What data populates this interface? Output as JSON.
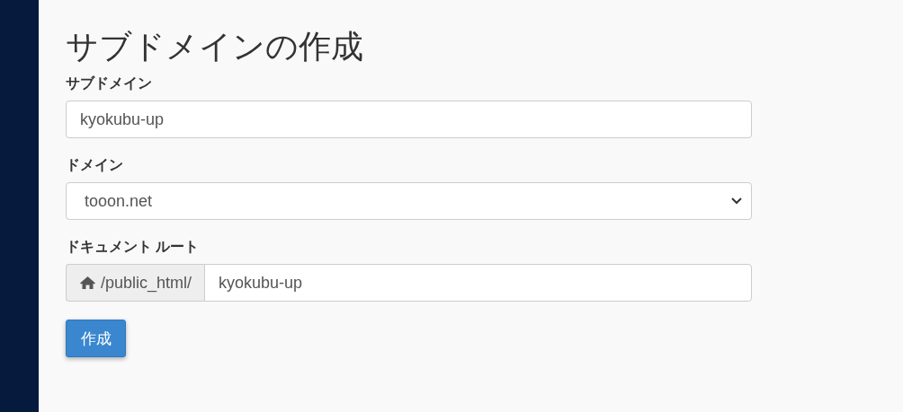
{
  "page_title": "サブドメインの作成",
  "fields": [
    {
      "kind": "text",
      "label": "サブドメイン",
      "value": "kyokubu-up"
    },
    {
      "kind": "select",
      "label": "ドメイン",
      "value": "tooon.net"
    },
    {
      "kind": "addon",
      "label": "ドキュメント ルート",
      "addon": "/public_html/",
      "value": "kyokubu-up"
    }
  ],
  "submit_button": "作成"
}
